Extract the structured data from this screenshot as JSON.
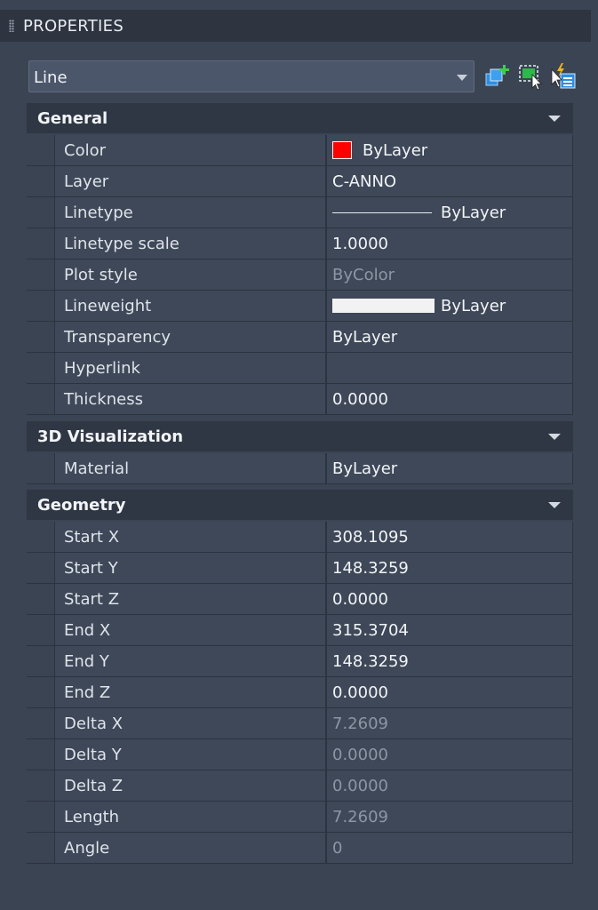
{
  "palette": {
    "title": "PROPERTIES"
  },
  "selector": {
    "value": "Line"
  },
  "toolbar": {
    "icons": [
      "toggle-pickadd-icon",
      "select-objects-icon",
      "quick-select-icon"
    ]
  },
  "sections": {
    "general": {
      "title": "General",
      "rows": [
        {
          "name": "Color",
          "value": "ByLayer"
        },
        {
          "name": "Layer",
          "value": "C-ANNO"
        },
        {
          "name": "Linetype",
          "value": "ByLayer"
        },
        {
          "name": "Linetype scale",
          "value": "1.0000"
        },
        {
          "name": "Plot style",
          "value": "ByColor"
        },
        {
          "name": "Lineweight",
          "value": "ByLayer"
        },
        {
          "name": "Transparency",
          "value": "ByLayer"
        },
        {
          "name": "Hyperlink",
          "value": ""
        },
        {
          "name": "Thickness",
          "value": "0.0000"
        }
      ]
    },
    "visualization": {
      "title": "3D Visualization",
      "rows": [
        {
          "name": "Material",
          "value": "ByLayer"
        }
      ]
    },
    "geometry": {
      "title": "Geometry",
      "rows": [
        {
          "name": "Start X",
          "value": "308.1095"
        },
        {
          "name": "Start Y",
          "value": "148.3259"
        },
        {
          "name": "Start Z",
          "value": "0.0000"
        },
        {
          "name": "End X",
          "value": "315.3704"
        },
        {
          "name": "End Y",
          "value": "148.3259"
        },
        {
          "name": "End Z",
          "value": "0.0000"
        },
        {
          "name": "Delta X",
          "value": "7.2609"
        },
        {
          "name": "Delta Y",
          "value": "0.0000"
        },
        {
          "name": "Delta Z",
          "value": "0.0000"
        },
        {
          "name": "Length",
          "value": "7.2609"
        },
        {
          "name": "Angle",
          "value": "0"
        }
      ]
    }
  },
  "colors": {
    "swatch_color": "#ff0000",
    "panel_bg": "#3b4453",
    "header_bg": "#2f3744"
  }
}
